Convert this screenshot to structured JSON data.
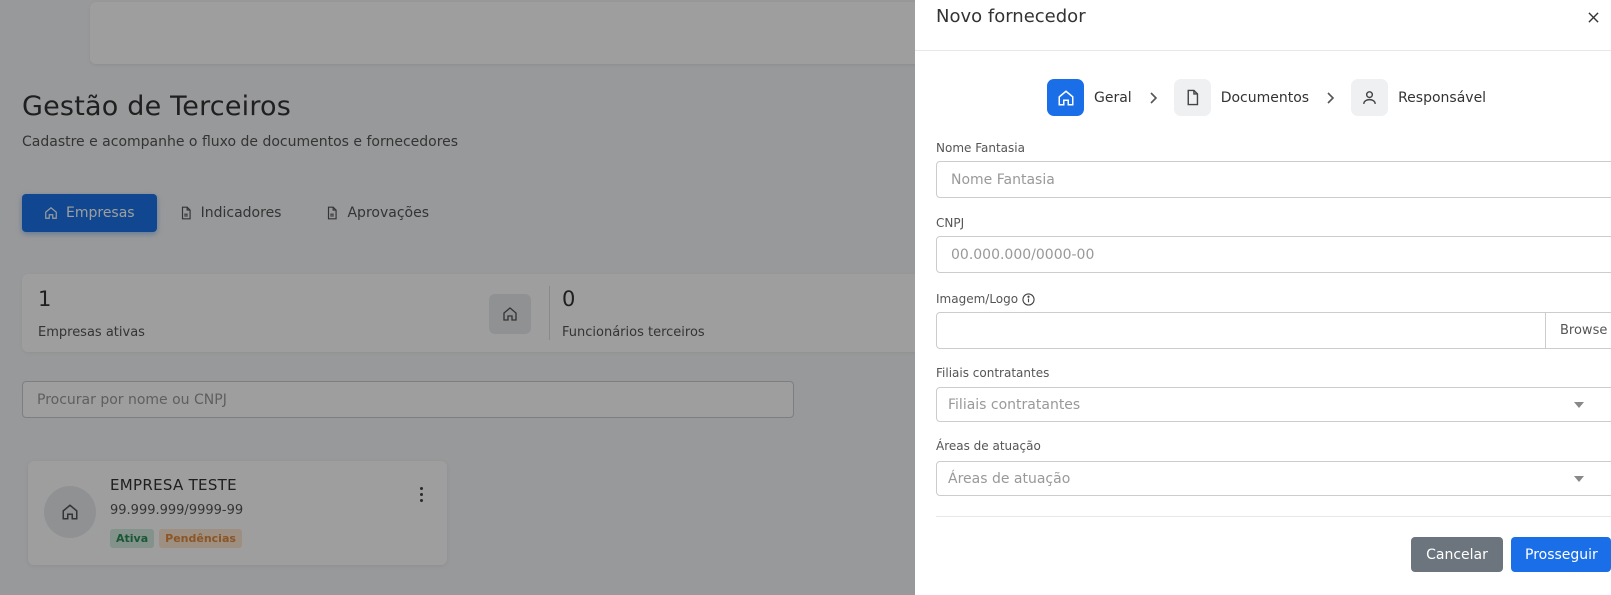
{
  "page": {
    "title": "Gestão de Terceiros",
    "subtitle": "Cadastre e acompanhe o fluxo de documentos e fornecedores",
    "tabs": [
      {
        "label": "Empresas",
        "icon": "home-icon",
        "active": true
      },
      {
        "label": "Indicadores",
        "icon": "document-icon",
        "active": false
      },
      {
        "label": "Aprovações",
        "icon": "document-icon",
        "active": false
      }
    ],
    "stats": [
      {
        "value": "1",
        "label": "Empresas ativas"
      },
      {
        "value": "0",
        "label": "Funcionários terceiros"
      }
    ],
    "search_placeholder": "Procurar por nome ou CNPJ",
    "company": {
      "name": "EMPRESA TESTE",
      "cnpj": "99.999.999/9999-99",
      "badges": [
        {
          "label": "Ativa",
          "color": "#2e8b57",
          "bg": "#d4ede0"
        },
        {
          "label": "Pendências",
          "color": "#e08a3c",
          "bg": "#fde8d4"
        }
      ]
    }
  },
  "drawer": {
    "title": "Novo fornecedor",
    "close_icon": "close-icon",
    "steps": [
      {
        "label": "Geral",
        "icon": "home-icon",
        "active": true
      },
      {
        "label": "Documentos",
        "icon": "file-icon",
        "active": false
      },
      {
        "label": "Responsável",
        "icon": "user-icon",
        "active": false
      }
    ],
    "fields": {
      "nome_fantasia": {
        "label": "Nome Fantasia",
        "placeholder": "Nome Fantasia",
        "value": ""
      },
      "cnpj": {
        "label": "CNPJ",
        "placeholder": "00.000.000/0000-00",
        "value": ""
      },
      "imagem": {
        "label": "Imagem/Logo",
        "browse": "Browse",
        "info_icon": "info-icon"
      },
      "filiais": {
        "label": "Filiais contratantes",
        "placeholder": "Filiais contratantes"
      },
      "areas": {
        "label": "Áreas de atuação",
        "placeholder": "Áreas de atuação"
      }
    },
    "buttons": {
      "cancel": "Cancelar",
      "next": "Prosseguir"
    }
  },
  "colors": {
    "primary": "#1a6fe8",
    "secondary": "#6c757d",
    "overlay": "rgba(0,0,0,0.38)"
  }
}
